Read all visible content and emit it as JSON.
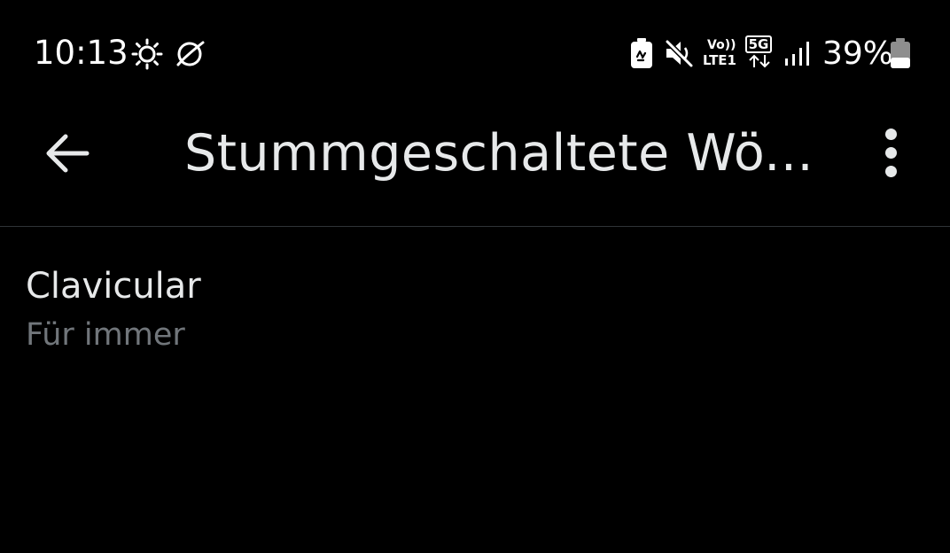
{
  "status_bar": {
    "time": "10:13",
    "icons": [
      "brightness-icon",
      "browser-planet-icon",
      "battery-saver-icon",
      "mute-icon",
      "volte-icon",
      "5g-icon",
      "signal-icon",
      "battery-icon"
    ],
    "volte_top": "Vo))",
    "volte_bottom": "LTE1",
    "network": "5G",
    "battery_percent": "39%",
    "battery_level": 0.39
  },
  "app_bar": {
    "title": "Stummgeschaltete Wö..."
  },
  "muted_words": [
    {
      "word": "Clavicular",
      "duration": "Für immer"
    }
  ],
  "colors": {
    "background": "#000000",
    "primary_text": "#e7e9ea",
    "secondary_text": "#71767b",
    "divider": "#2f3336"
  }
}
